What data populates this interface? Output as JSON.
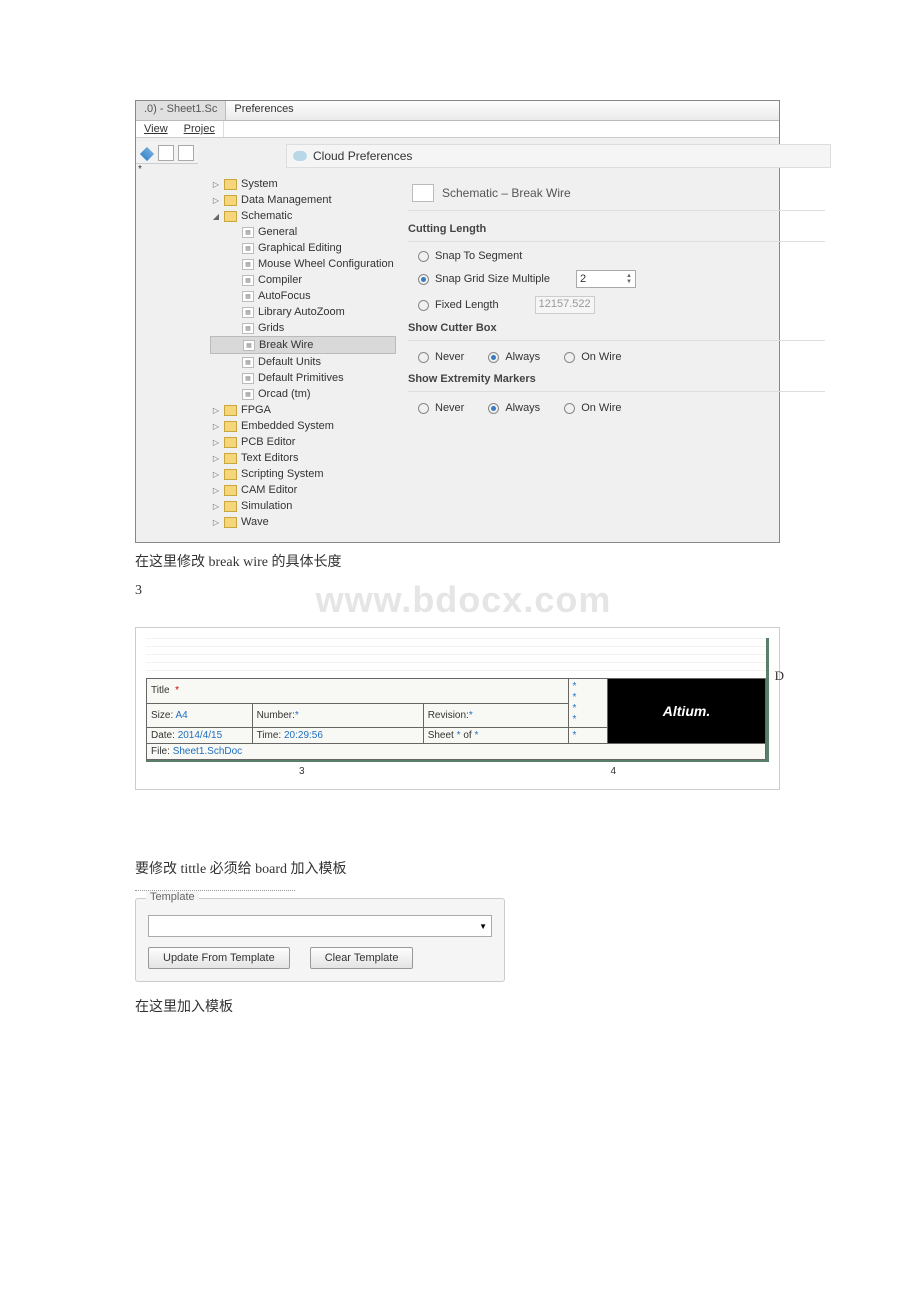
{
  "window": {
    "tab_title": ".0) - Sheet1.Sc",
    "title": "Preferences",
    "menu": {
      "view": "View",
      "project": "Projec"
    },
    "cloud_label": "Cloud Preferences"
  },
  "tree": {
    "system": "System",
    "data_management": "Data Management",
    "schematic": "Schematic",
    "general": "General",
    "graphical_editing": "Graphical Editing",
    "mouse_wheel": "Mouse Wheel Configuration",
    "compiler": "Compiler",
    "autofocus": "AutoFocus",
    "library_autozoom": "Library AutoZoom",
    "grids": "Grids",
    "break_wire": "Break Wire",
    "default_units": "Default Units",
    "default_primitives": "Default Primitives",
    "orcad": "Orcad (tm)",
    "fpga": "FPGA",
    "embedded": "Embedded System",
    "pcb_editor": "PCB Editor",
    "text_editors": "Text Editors",
    "scripting": "Scripting System",
    "cam_editor": "CAM Editor",
    "simulation": "Simulation",
    "wave": "Wave"
  },
  "settings": {
    "header": "Schematic – Break Wire",
    "cutting_length": {
      "title": "Cutting Length",
      "snap_segment": "Snap To Segment",
      "snap_grid": "Snap Grid Size Multiple",
      "grid_value": "2",
      "fixed_length": "Fixed Length",
      "fixed_value": "12157.522"
    },
    "cutter_box": {
      "title": "Show Cutter Box",
      "never": "Never",
      "always": "Always",
      "on_wire": "On Wire"
    },
    "extremity": {
      "title": "Show Extremity Markers",
      "never": "Never",
      "always": "Always",
      "on_wire": "On Wire"
    }
  },
  "annotations": {
    "break_wire_note": "在这里修改 break wire 的具体长度",
    "page_num": "3",
    "watermark": "www.bdocx.com",
    "title_note": "要修改 tittle 必须给 board 加入模板",
    "template_note": "在这里加入模板"
  },
  "title_block": {
    "d": "D",
    "title_lbl": "Title",
    "title_val": "*",
    "size_lbl": "Size:",
    "size_val": "A4",
    "number_lbl": "Number:",
    "number_val": "*",
    "revision_lbl": "Revision:",
    "revision_val": "*",
    "date_lbl": "Date:",
    "date_val": "2014/4/15",
    "time_lbl": "Time:",
    "time_val": "20:29:56",
    "sheet_lbl": "Sheet",
    "sheet_val": "*",
    "of_lbl": "of",
    "of_val": "*",
    "file_lbl": "File:",
    "file_val": "Sheet1.SchDoc",
    "star": "*",
    "logo": "Altium.",
    "col3": "3",
    "col4": "4"
  },
  "template": {
    "legend": "Template",
    "update_btn": "Update From Template",
    "clear_btn": "Clear Template"
  }
}
